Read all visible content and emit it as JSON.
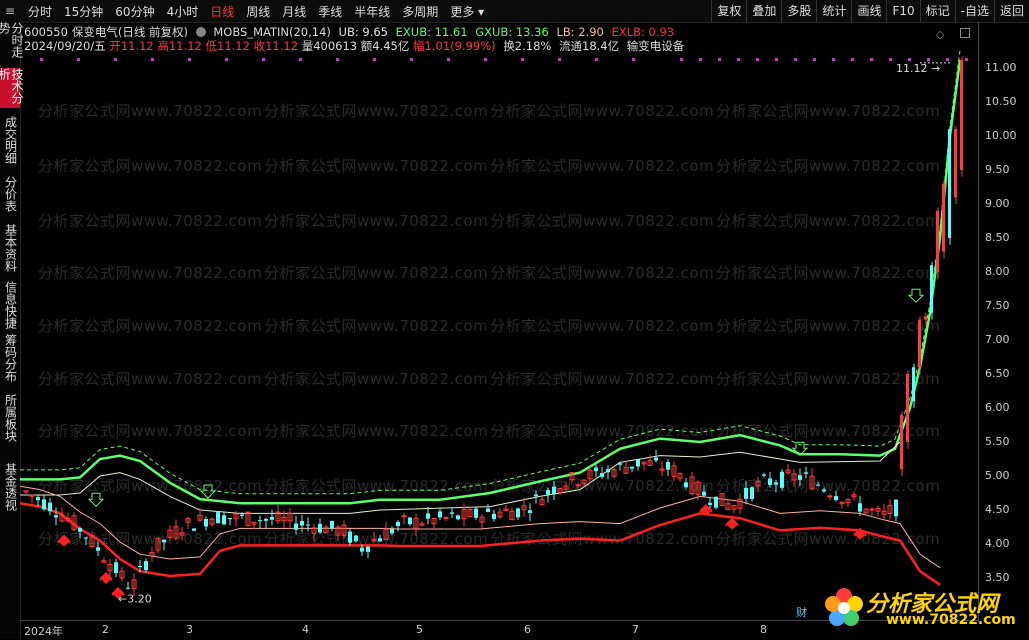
{
  "toolbar": {
    "periods": [
      "分时",
      "15分钟",
      "60分钟",
      "4小时",
      "日线",
      "周线",
      "月线",
      "季线",
      "半年线",
      "多周期",
      "更多"
    ],
    "active_period": "日线",
    "tools": [
      "复权",
      "叠加",
      "多股",
      "统计",
      "画线",
      "F10",
      "标记",
      "-自选",
      "返回"
    ]
  },
  "sidebar": {
    "tabs": [
      "分时走势",
      "技术分析",
      "成交明细",
      "分价表",
      "基本资料",
      "信息快捷",
      "筹码分布",
      "所属板块",
      "基金透视"
    ],
    "active": "技术分析"
  },
  "stock": {
    "code": "600550",
    "name": "保变电气",
    "mode": "(日线 前复权)",
    "indicator": "MOBS_MATIN(20,14)",
    "ub": "UB: 9.65",
    "exub": "EXUB: 11.61",
    "gxub": "GXUB: 13.36",
    "lb": "LB: 2.90",
    "exlb": "EXLB: 0.93",
    "date": "2024/09/20/五",
    "open": "开11.12",
    "high": "高11.12",
    "low": "低11.12",
    "close": "收11.12",
    "volume": "量400613",
    "amount": "额4.45亿",
    "change": "幅1.01(9.99%)",
    "turnover": "换2.18%",
    "float": "流通18.4亿",
    "sector": "输变电设备"
  },
  "price_axis": [
    "11.00",
    "10.50",
    "10.00",
    "9.50",
    "9.00",
    "8.50",
    "8.00",
    "7.50",
    "7.00",
    "6.50",
    "6.00",
    "5.50",
    "5.00",
    "4.50",
    "4.00",
    "3.50"
  ],
  "date_axis": [
    "2024年",
    "2",
    "3",
    "4",
    "5",
    "6",
    "7",
    "8"
  ],
  "annotations": {
    "high_label": "11.12",
    "low_label": "3.20",
    "badge": "财"
  },
  "watermark": "分析家公式网www.70822.com",
  "logo": {
    "name": "分析家公式网",
    "url": "www.70822.com"
  },
  "colors": {
    "up": "#ff3b3b",
    "down": "#54ffff",
    "ub": "#5dff6a",
    "lb": "#ff2020",
    "mid_up": "#e6f0d0",
    "mid_dn": "#ffb0a0",
    "accent": "#c8102e"
  }
}
